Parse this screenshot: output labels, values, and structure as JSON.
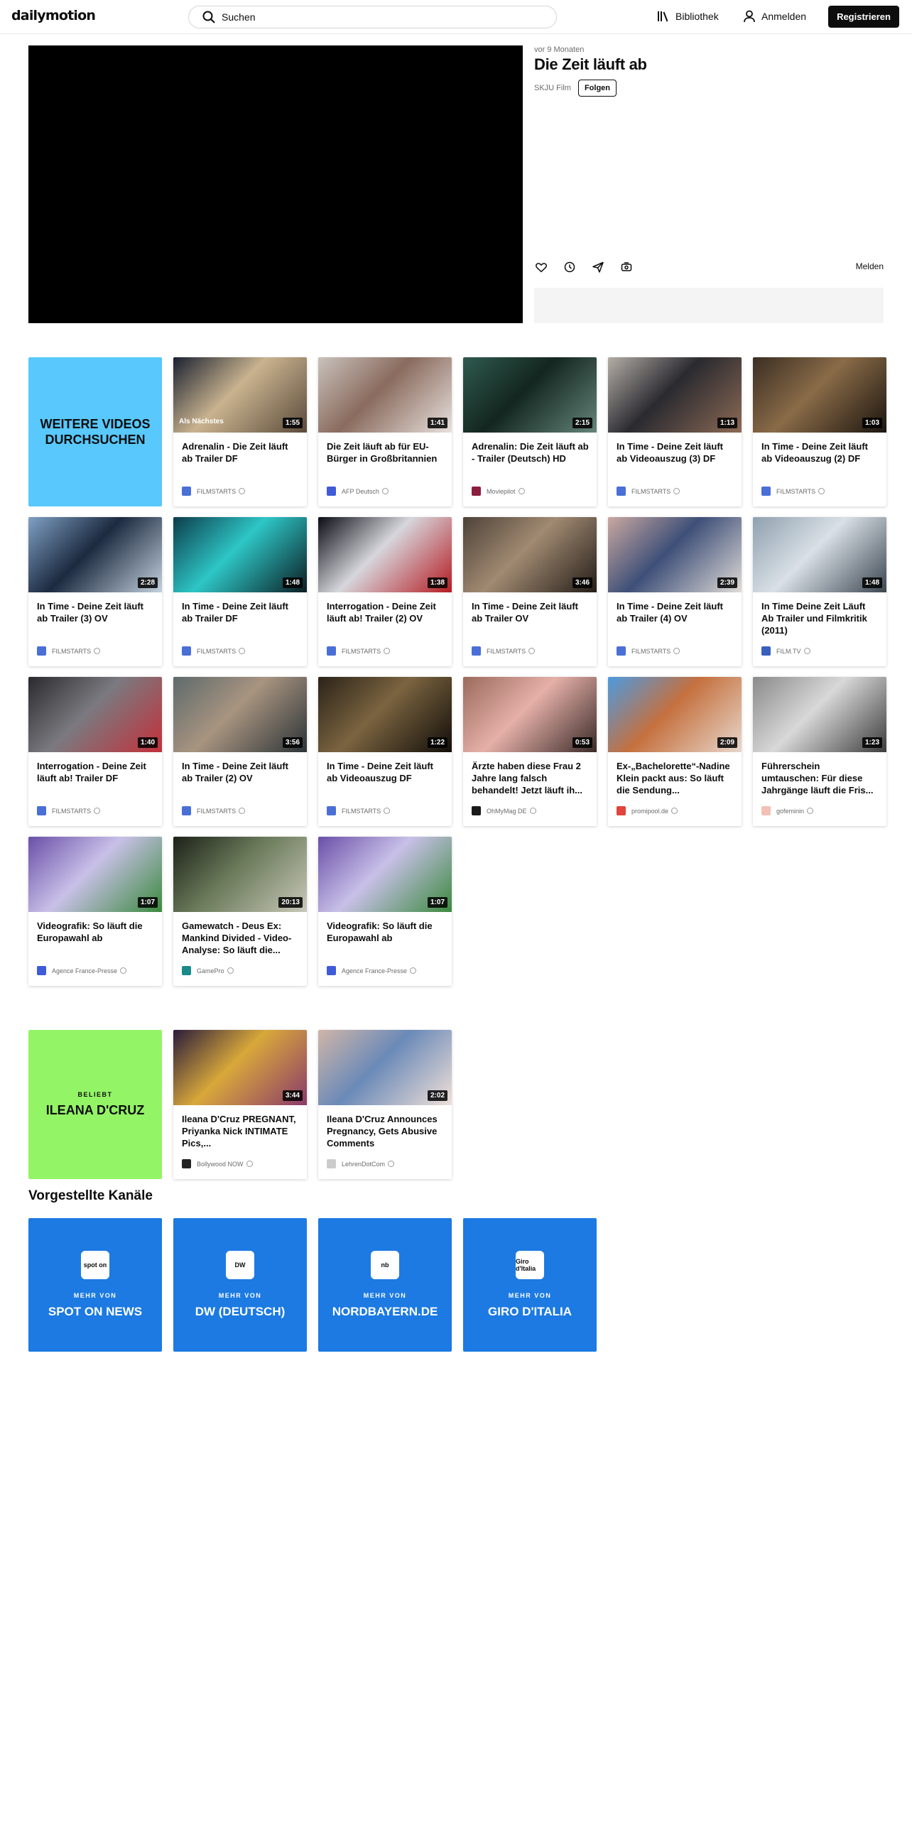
{
  "header": {
    "logo": "dailymotion",
    "search_placeholder": "Suchen",
    "library_label": "Bibliothek",
    "login_label": "Anmelden",
    "register_label": "Registrieren"
  },
  "video": {
    "age": "vor 9 Monaten",
    "title": "Die Zeit läuft ab",
    "channel": "SKJU Film",
    "follow_label": "Folgen",
    "report_label": "Melden",
    "action_icons": [
      "heart-icon",
      "clock-icon",
      "share-icon",
      "embed-icon"
    ]
  },
  "browse_promo": {
    "label": "WEITERE VIDEOS DURCHSUCHEN",
    "color": "#58c8fd"
  },
  "videos": [
    {
      "title": "Adrenalin - Die Zeit läuft ab Trailer DF",
      "duration": "1:55",
      "channel": "FILMSTARTS",
      "badge": "Als Nächstes",
      "thumb": [
        "#1b2030",
        "#c9b38f",
        "#5a4a3a"
      ],
      "avatar": "#4a6fd6"
    },
    {
      "title": "Die Zeit läuft ab für EU-Bürger in Großbritannien",
      "duration": "1:41",
      "channel": "AFP Deutsch",
      "badge": "",
      "thumb": [
        "#c9c2bd",
        "#8a6b5e",
        "#e8e1dd"
      ],
      "avatar": "#3f5bd8"
    },
    {
      "title": "Adrenalin: Die Zeit läuft ab - Trailer (Deutsch) HD",
      "duration": "2:15",
      "channel": "Moviepilot",
      "badge": "",
      "thumb": [
        "#2f5a4f",
        "#13261f",
        "#64857a"
      ],
      "avatar": "#8b1e3f"
    },
    {
      "title": "In Time - Deine Zeit läuft ab Videoauszug (3) DF",
      "duration": "1:13",
      "channel": "FILMSTARTS",
      "badge": "",
      "thumb": [
        "#b4aea6",
        "#2a2a30",
        "#8c6a55"
      ],
      "avatar": "#4a6fd6"
    },
    {
      "title": "In Time - Deine Zeit läuft ab Videoauszug (2) DF",
      "duration": "1:03",
      "channel": "FILMSTARTS",
      "badge": "",
      "thumb": [
        "#3a2e23",
        "#8a6b48",
        "#1c150f"
      ],
      "avatar": "#4a6fd6"
    },
    {
      "title": "In Time - Deine Zeit läuft ab Trailer (3) OV",
      "duration": "2:28",
      "channel": "FILMSTARTS",
      "badge": "",
      "thumb": [
        "#7fa0c4",
        "#1c2a40",
        "#c3d1de"
      ],
      "avatar": "#4a6fd6"
    },
    {
      "title": "In Time - Deine Zeit läuft ab Trailer DF",
      "duration": "1:48",
      "channel": "FILMSTARTS",
      "badge": "",
      "thumb": [
        "#0c3c4a",
        "#2ec6c6",
        "#0a1c22"
      ],
      "avatar": "#4a6fd6"
    },
    {
      "title": "Interrogation - Deine Zeit läuft ab! Trailer (2) OV",
      "duration": "1:38",
      "channel": "FILMSTARTS",
      "badge": "",
      "thumb": [
        "#0b0b14",
        "#d6d6dc",
        "#b51b22"
      ],
      "avatar": "#4a6fd6"
    },
    {
      "title": "In Time - Deine Zeit läuft ab Trailer OV",
      "duration": "3:46",
      "channel": "FILMSTARTS",
      "badge": "",
      "thumb": [
        "#4d4238",
        "#a18a72",
        "#241d18"
      ],
      "avatar": "#4a6fd6"
    },
    {
      "title": "In Time - Deine Zeit läuft ab Trailer (4) OV",
      "duration": "2:39",
      "channel": "FILMSTARTS",
      "badge": "",
      "thumb": [
        "#c9a8a0",
        "#3e4f78",
        "#e0dcd8"
      ],
      "avatar": "#4a6fd6"
    },
    {
      "title": "In Time Deine Zeit Läuft Ab Trailer und Filmkritik (2011)",
      "duration": "1:48",
      "channel": "FILM.TV",
      "badge": "",
      "thumb": [
        "#8fa0ae",
        "#d9e0e6",
        "#3b4651"
      ],
      "avatar": "#3a5fbf"
    },
    {
      "title": "Interrogation - Deine Zeit läuft ab! Trailer DF",
      "duration": "1:40",
      "channel": "FILMSTARTS",
      "badge": "",
      "thumb": [
        "#2a2a2e",
        "#7a7a80",
        "#c4303a"
      ],
      "avatar": "#4a6fd6"
    },
    {
      "title": "In Time - Deine Zeit läuft ab Trailer (2) OV",
      "duration": "3:56",
      "channel": "FILMSTARTS",
      "badge": "",
      "thumb": [
        "#5e6a6c",
        "#a89480",
        "#2c3336"
      ],
      "avatar": "#4a6fd6"
    },
    {
      "title": "In Time - Deine Zeit läuft ab Videoauszug DF",
      "duration": "1:22",
      "channel": "FILMSTARTS",
      "badge": "",
      "thumb": [
        "#2b2319",
        "#7b6440",
        "#120e09"
      ],
      "avatar": "#4a6fd6"
    },
    {
      "title": "Ärzte haben diese Frau 2 Jahre lang falsch behandelt! Jetzt läuft ih...",
      "duration": "0:53",
      "channel": "OhMyMag DE",
      "badge": "",
      "thumb": [
        "#9b6a5c",
        "#e5b0a8",
        "#3a2a28"
      ],
      "avatar": "#1a1a1a"
    },
    {
      "title": "Ex-„Bachelorette“-Nadine Klein packt aus: So läuft die Sendung...",
      "duration": "2:09",
      "channel": "promipool.de",
      "badge": "",
      "thumb": [
        "#4c9be0",
        "#c5703e",
        "#e7d8cc"
      ],
      "avatar": "#e0443c"
    },
    {
      "title": "Führerschein umtauschen: Für diese Jahrgänge läuft die Fris...",
      "duration": "1:23",
      "channel": "gofeminin",
      "badge": "",
      "thumb": [
        "#8a8a8a",
        "#d8d8d8",
        "#3c3c3c"
      ],
      "avatar": "#f3c0b8"
    },
    {
      "title": "Videografik: So läuft die Europawahl ab",
      "duration": "1:07",
      "channel": "Agence France-Presse",
      "badge": "",
      "thumb": [
        "#6a4fa8",
        "#c8c0e8",
        "#3c8a3e"
      ],
      "avatar": "#3f5bd8"
    },
    {
      "title": "Gamewatch - Deus Ex: Mankind Divided - Video-Analyse: So läuft die...",
      "duration": "20:13",
      "channel": "GamePro",
      "badge": "",
      "thumb": [
        "#1c2118",
        "#6a7a5a",
        "#c8c8b8"
      ],
      "avatar": "#1b8a8a"
    },
    {
      "title": "Videografik: So läuft die Europawahl ab",
      "duration": "1:07",
      "channel": "Agence France-Presse",
      "badge": "",
      "thumb": [
        "#6a4fa8",
        "#c8c0e8",
        "#3c8a3e"
      ],
      "avatar": "#3f5bd8"
    }
  ],
  "popular_promo": {
    "kicker": "BELIEBT",
    "label": "ILEANA D'CRUZ",
    "color": "#93f466"
  },
  "popular_videos": [
    {
      "title": "Ileana D'Cruz PREGNANT, Priyanka Nick INTIMATE Pics,...",
      "duration": "3:44",
      "channel": "Bollywood NOW",
      "badge": "",
      "thumb": [
        "#2a1c3a",
        "#d8a83a",
        "#8a3a6a"
      ],
      "avatar": "#222222"
    },
    {
      "title": "Ileana D'Cruz Announces Pregnancy, Gets Abusive Comments",
      "duration": "2:02",
      "channel": "LehrenDotCom",
      "badge": "",
      "thumb": [
        "#d0b5a8",
        "#6a8ab8",
        "#f0e0d8"
      ],
      "avatar": "#cccccc"
    }
  ],
  "featured": {
    "title": "Vorgestellte Kanäle",
    "more_label": "MEHR VON",
    "channels": [
      {
        "name": "SPOT ON NEWS",
        "logo": "spot on"
      },
      {
        "name": "DW (DEUTSCH)",
        "logo": "DW"
      },
      {
        "name": "NORDBAYERN.DE",
        "logo": "nb"
      },
      {
        "name": "GIRO D'ITALIA",
        "logo": "Giro d'Italia"
      }
    ]
  }
}
